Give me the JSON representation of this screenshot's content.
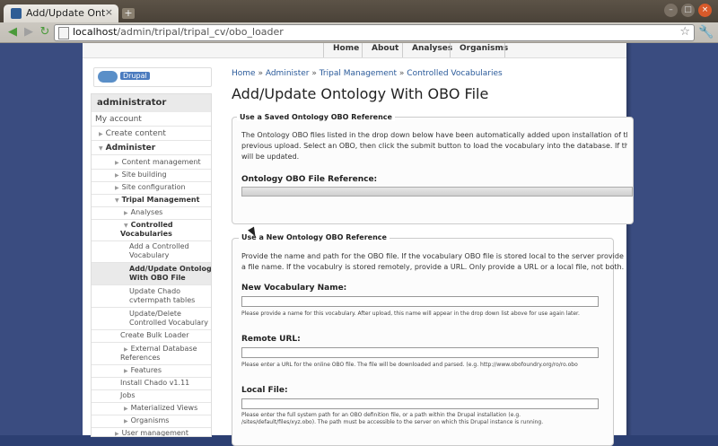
{
  "browser": {
    "tab_title": "Add/Update Ontology...",
    "tab_close": "×",
    "new_tab": "+",
    "url_host": "localhost",
    "url_path": "/admin/tripal/tripal_cv/obo_loader",
    "back": "◀",
    "forward": "▶",
    "reload": "↻",
    "star": "☆",
    "wrench": "🔧"
  },
  "topnav": [
    "Home",
    "About",
    "Analyses",
    "Organisms"
  ],
  "logo_text": "Drupal",
  "sidebar": {
    "user": "administrator",
    "items": [
      {
        "label": "My account"
      },
      {
        "label": "Create content"
      },
      {
        "label": "Administer"
      },
      {
        "label": "Content management"
      },
      {
        "label": "Site building"
      },
      {
        "label": "Site configuration"
      },
      {
        "label": "Tripal Management"
      },
      {
        "label": "Analyses"
      },
      {
        "label": "Controlled"
      },
      {
        "label": "Vocabularies"
      },
      {
        "label": "Add a Controlled"
      },
      {
        "label": "Vocabulary"
      },
      {
        "label": "Add/Update Ontology"
      },
      {
        "label": "With OBO File"
      },
      {
        "label": "Update Chado"
      },
      {
        "label": "cvtermpath tables"
      },
      {
        "label": "Update/Delete"
      },
      {
        "label": "Controlled Vocabulary"
      },
      {
        "label": "Create Bulk Loader"
      },
      {
        "label": "External Database"
      },
      {
        "label": "References"
      },
      {
        "label": "Features"
      },
      {
        "label": "Install Chado v1.11"
      },
      {
        "label": "Jobs"
      },
      {
        "label": "Materialized Views"
      },
      {
        "label": "Organisms"
      },
      {
        "label": "User management"
      }
    ]
  },
  "breadcrumb": [
    "Home",
    "Administer",
    "Tripal Management",
    "Controlled Vocabularies"
  ],
  "breadcrumb_sep": "»",
  "page_title": "Add/Update Ontology With OBO File",
  "saved": {
    "legend": "Use a Saved Ontology OBO Reference",
    "text_1": "The Ontology OBO files listed in the drop down below have been automatically added upon installation of the Trip",
    "text_2": "previous upload. Select an OBO, then click the submit button to load the vocabulary into the database. If the vo",
    "text_3": "will be updated.",
    "select_label": "Ontology OBO File Reference:"
  },
  "new": {
    "legend": "Use a New Ontology OBO Reference",
    "text_1": "Provide the name and path for the OBO file. If the vocabulary OBO file is stored local to the server provide",
    "text_2": "a file name. If the vocabulry is stored remotely, provide a URL. Only provide a URL or a local file, not both.",
    "name_label": "New Vocabulary Name:",
    "name_desc": "Please provide a name for this vocabulary. After upload, this name will appear in the drop down list above for use again later.",
    "url_label": "Remote URL:",
    "url_desc": "Please enter a URL for the online OBO file. The file will be downloaded and parsed. (e.g. http://www.obofoundry.org/ro/ro.obo",
    "file_label": "Local File:",
    "file_desc_1": "Please enter the full system path for an OBO definition file, or a path within the Drupal installation (e.g.",
    "file_desc_2": "/sites/default/files/xyz.obo). The path must be accessible to the server on which this Drupal instance is running."
  }
}
